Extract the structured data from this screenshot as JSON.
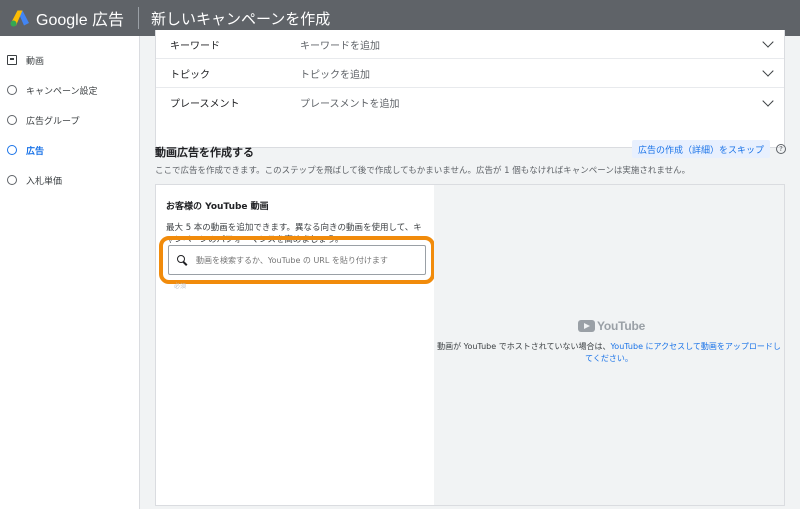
{
  "header": {
    "brand": "Google 広告",
    "title": "新しいキャンペーンを作成",
    "logo_colors": [
      "#fbbc04",
      "#4285f4",
      "#34a853"
    ]
  },
  "sidebar": {
    "items": [
      {
        "label": "動画",
        "icon": "video-icon",
        "state": "done"
      },
      {
        "label": "キャンペーン設定",
        "icon": "step-circle-icon",
        "state": "pending"
      },
      {
        "label": "広告グループ",
        "icon": "step-circle-icon",
        "state": "pending"
      },
      {
        "label": "広告",
        "icon": "step-circle-icon",
        "state": "active"
      },
      {
        "label": "入札単価",
        "icon": "step-circle-icon",
        "state": "pending"
      }
    ]
  },
  "targeting": {
    "rows": [
      {
        "label": "キーワード",
        "value": "キーワードを追加"
      },
      {
        "label": "トピック",
        "value": "トピックを追加"
      },
      {
        "label": "プレースメント",
        "value": "プレースメントを追加"
      }
    ]
  },
  "create_ad": {
    "title": "動画広告を作成する",
    "skip_label": "広告の作成（詳細）をスキップ",
    "help": "?",
    "description": "ここで広告を作成できます。このステップを飛ばして後で作成してもかまいません。広告が 1 個もなければキャンペーンは実施されません。"
  },
  "video_panel": {
    "title": "お客様の YouTube 動画",
    "description": "最大 5 本の動画を追加できます。異なる向きの動画を使用して、キャンペーンのパフォーマンスを高めましょう。",
    "search_placeholder": "動画を検索するか、YouTube の URL を貼り付けます",
    "required": "必須",
    "youtube_wordmark": "YouTube",
    "upload_note_prefix": "動画が YouTube でホストされていない場合は、",
    "upload_link": "YouTube にアクセスして動画をアップロードしてください。",
    "highlight_color": "#f18b0b"
  }
}
